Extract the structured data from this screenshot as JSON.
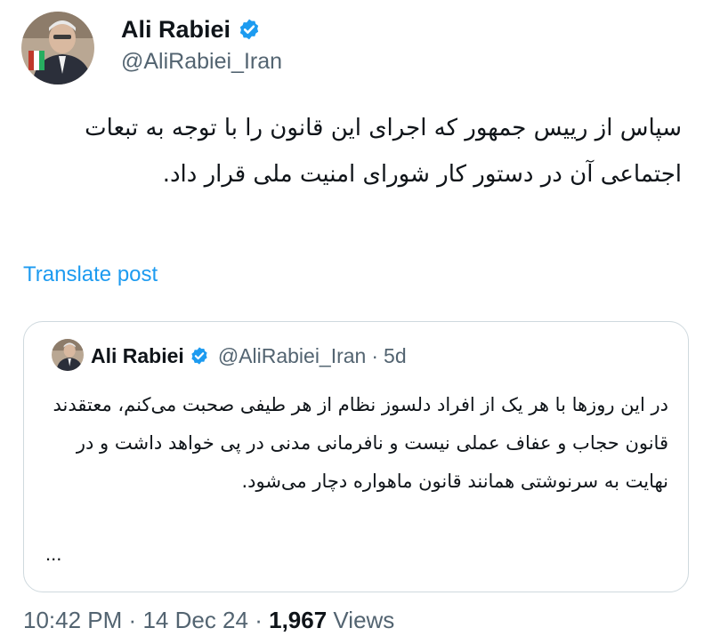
{
  "author": {
    "name": "Ali Rabiei",
    "handle": "@AliRabiei_Iran",
    "verified": true,
    "avatar_icon": "profile-photo"
  },
  "post": {
    "text": "سپاس از رییس جمهور که اجرای این قانون را با توجه به تبعات اجتماعی آن در دستور کار شورای امنیت ملی قرار داد.",
    "translate_label": "Translate post"
  },
  "quoted_post": {
    "name": "Ali Rabiei",
    "handle": "@AliRabiei_Iran",
    "separator": "·",
    "time_ago": "5d",
    "text": "در این روزها با هر یک از افراد دلسوز نظام از هر طیفی صحبت می‌کنم، معتقدند قانون حجاب و عفاف عملی نیست و نافرمانی مدنی در پی خواهد داشت و در نهایت به سرنوشتی همانند قانون ماهواره دچار می‌شود.",
    "more": "..."
  },
  "meta": {
    "time": "10:42 PM",
    "separator": "·",
    "date": "14 Dec 24",
    "views_count": "1,967",
    "views_label": "Views"
  },
  "colors": {
    "link": "#1d9bf0",
    "verified_badge": "#1d9bf0",
    "secondary_text": "#536471",
    "primary_text": "#0f1419",
    "border": "#cfd9de"
  }
}
